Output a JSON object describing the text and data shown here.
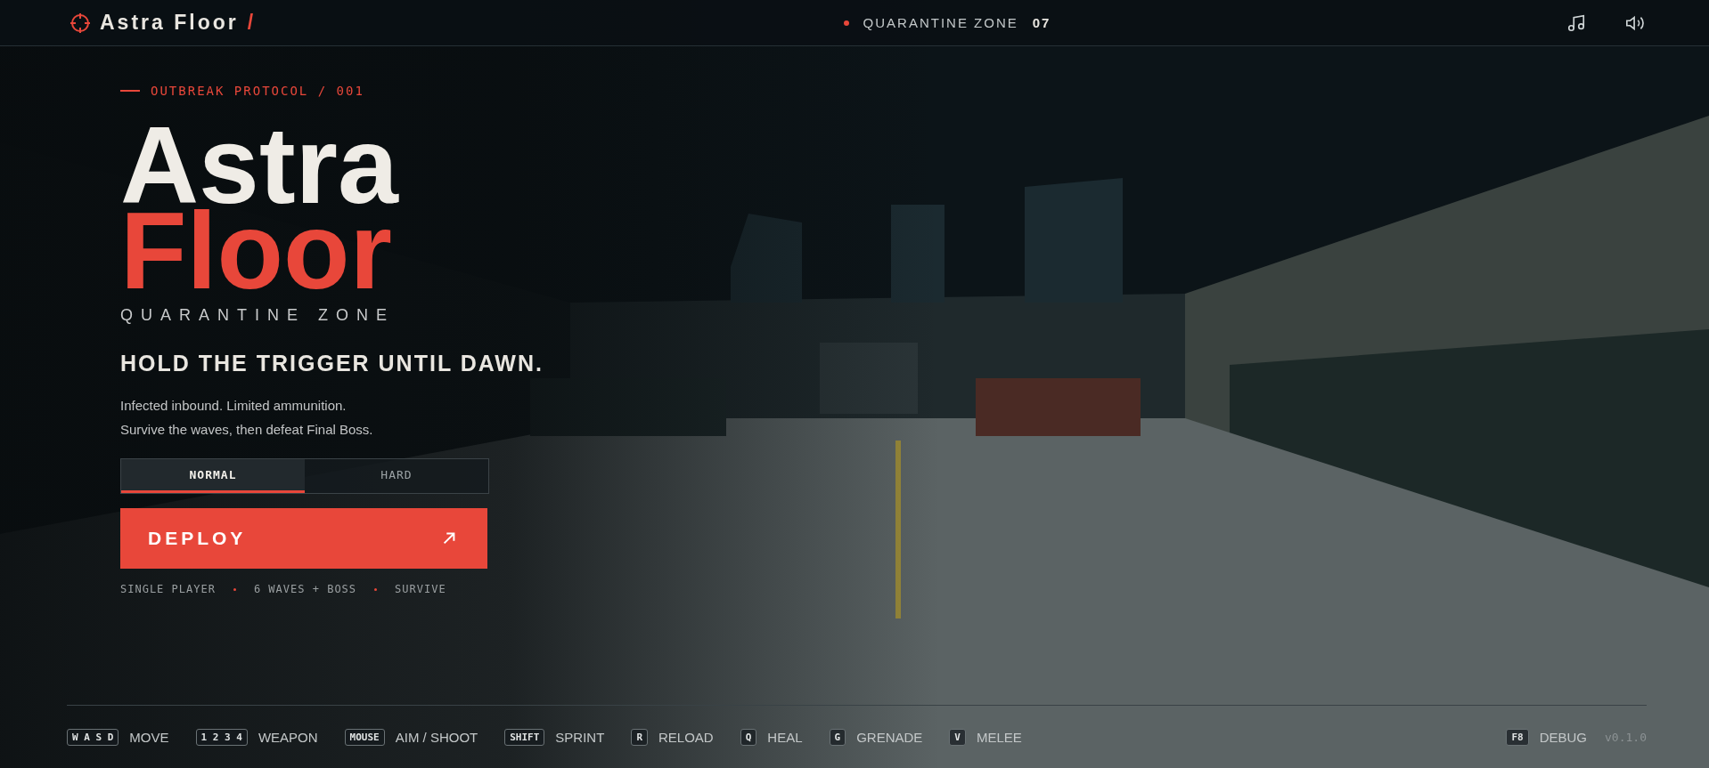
{
  "header": {
    "brand": "Astra Floor",
    "brand_mark": "/",
    "zone_label": "QUARANTINE ZONE",
    "zone_number": "07"
  },
  "hero": {
    "eyebrow": "OUTBREAK PROTOCOL / 001",
    "title_line_1": "Astra",
    "title_line_2": "Floor",
    "subtitle": "QUARANTINE ZONE",
    "headline": "HOLD THE TRIGGER UNTIL DAWN.",
    "description": [
      "Infected inbound. Limited ammunition.",
      "Survive the waves, then defeat Final Boss."
    ]
  },
  "difficulty": [
    {
      "label": "NORMAL",
      "selected": true
    },
    {
      "label": "HARD",
      "selected": false
    }
  ],
  "deploy_button": "DEPLOY",
  "meta": [
    "SINGLE PLAYER",
    "6 WAVES + BOSS",
    "SURVIVE"
  ],
  "controls": [
    {
      "key": "W A S D",
      "action": "MOVE"
    },
    {
      "key": "1 2 3 4",
      "action": "WEAPON"
    },
    {
      "key": "MOUSE",
      "action": "AIM / SHOOT"
    },
    {
      "key": "SHIFT",
      "action": "SPRINT"
    },
    {
      "key": "R",
      "action": "RELOAD"
    },
    {
      "key": "Q",
      "action": "HEAL"
    },
    {
      "key": "G",
      "action": "GRENADE"
    },
    {
      "key": "V",
      "action": "MELEE"
    }
  ],
  "debug": {
    "key": "F8",
    "action": "DEBUG"
  },
  "version": "v0.1.0"
}
